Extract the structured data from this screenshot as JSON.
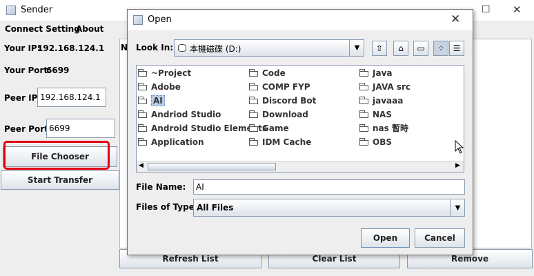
{
  "sender": {
    "title": "Sender",
    "menu": [
      "Connect Setting",
      "About"
    ],
    "your_ip_label": "Your IP:",
    "your_ip_value": "192.168.124.1",
    "your_port_label": "Your Port:",
    "your_port_value": "6699",
    "peer_ip_label": "Peer IP:",
    "peer_ip_value": "192.168.124.1",
    "peer_port_label": "Peer Port:",
    "peer_port_value": "6699",
    "file_chooser_label": "File Chooser",
    "start_transfer_label": "Start Transfer",
    "refresh_list_label": "Refresh List",
    "clear_list_label": "Clear List",
    "remove_label": "Remove",
    "list_header_fragment": "N",
    "highlight_color": "#e3000f"
  },
  "dialog": {
    "title": "Open",
    "look_in_label": "Look In:",
    "look_in_value": "本機磁碟 (D:)",
    "files": [
      {
        "name": "~Project",
        "selected": false
      },
      {
        "name": "Adobe",
        "selected": false
      },
      {
        "name": "AI",
        "selected": true
      },
      {
        "name": "Andriod Studio",
        "selected": false
      },
      {
        "name": "Android Studio Elements",
        "selected": false
      },
      {
        "name": "Application",
        "selected": false
      },
      {
        "name": "Code",
        "selected": false
      },
      {
        "name": "COMP FYP",
        "selected": false
      },
      {
        "name": "Discord Bot",
        "selected": false
      },
      {
        "name": "Download",
        "selected": false
      },
      {
        "name": "Game",
        "selected": false
      },
      {
        "name": "IDM Cache",
        "selected": false
      },
      {
        "name": "Java",
        "selected": false
      },
      {
        "name": "JAVA src",
        "selected": false
      },
      {
        "name": "javaaa",
        "selected": false
      },
      {
        "name": "NAS",
        "selected": false
      },
      {
        "name": "nas 暫時",
        "selected": false
      },
      {
        "name": "OBS",
        "selected": false
      }
    ],
    "file_name_label": "File Name:",
    "file_name_value": "AI",
    "files_of_type_label": "Files of Type:",
    "files_of_type_value": "All Files",
    "open_label": "Open",
    "cancel_label": "Cancel",
    "close_glyph": "✕"
  },
  "window_controls": {
    "maximize_glyph": "☐",
    "close_glyph": "✕"
  }
}
